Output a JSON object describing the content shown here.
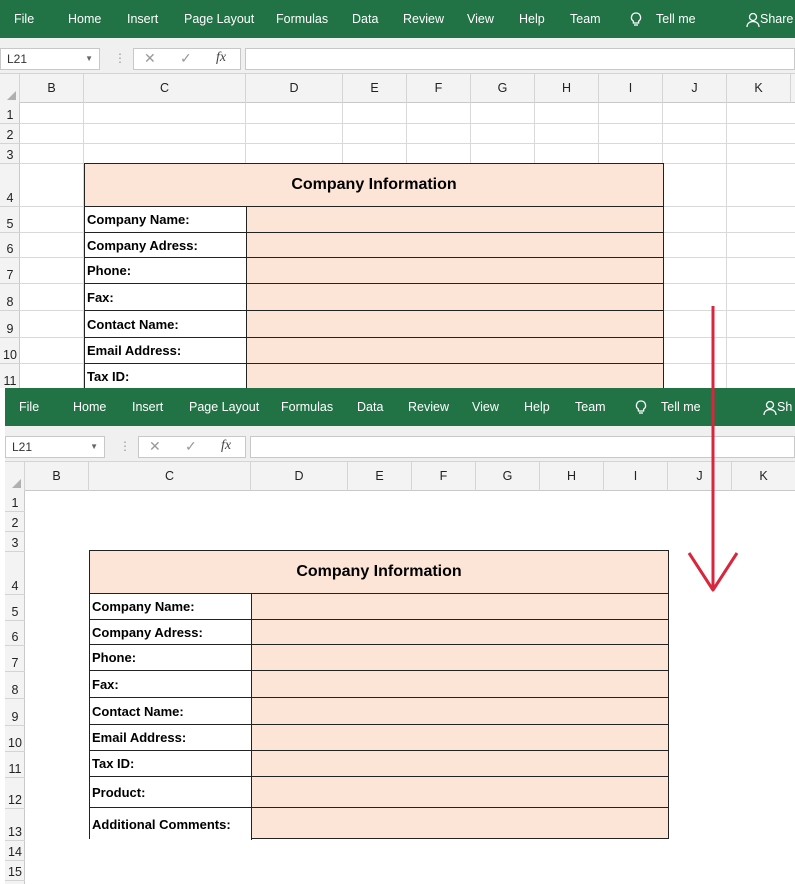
{
  "ribbon": {
    "tabs": [
      "File",
      "Home",
      "Insert",
      "Page Layout",
      "Formulas",
      "Data",
      "Review",
      "View",
      "Help",
      "Team"
    ],
    "tell_me": "Tell me",
    "share": "Share",
    "share_clipped": "Sh"
  },
  "formula_bar": {
    "name_box": "L21",
    "cancel_icon": "✕",
    "enter_icon": "✓",
    "fx_label": "fx",
    "value": ""
  },
  "columns": [
    "B",
    "C",
    "D",
    "E",
    "F",
    "G",
    "H",
    "I",
    "J",
    "K"
  ],
  "rows_top": [
    "1",
    "2",
    "3",
    "4",
    "5",
    "6",
    "7",
    "8",
    "9",
    "10",
    "11"
  ],
  "rows_bottom": [
    "1",
    "2",
    "3",
    "4",
    "5",
    "6",
    "7",
    "8",
    "9",
    "10",
    "11",
    "12",
    "13",
    "14",
    "15"
  ],
  "table": {
    "title": "Company Information",
    "labels_top": [
      "Company Name:",
      "Company Adress:",
      "Phone:",
      "Fax:",
      "Contact Name:",
      "Email Address:",
      "Tax ID:"
    ],
    "labels_bottom": [
      "Company Name:",
      "Company Adress:",
      "Phone:",
      "Fax:",
      "Contact Name:",
      "Email Address:",
      "Tax ID:",
      "Product:",
      "Additional Comments:"
    ]
  },
  "colors": {
    "ribbon": "#217346",
    "table_fill": "#fce4d6",
    "arrow": "#d7263d"
  }
}
